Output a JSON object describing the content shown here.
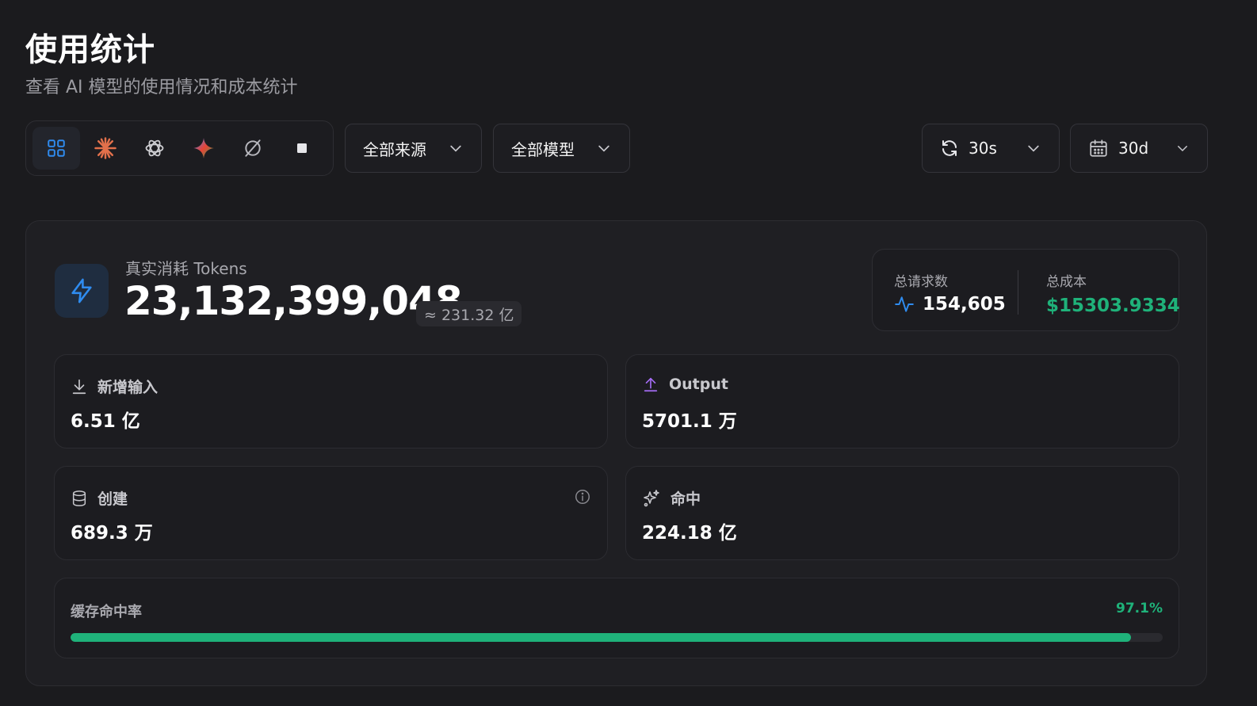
{
  "header": {
    "title": "使用统计",
    "subtitle": "查看 AI 模型的使用情况和成本统计"
  },
  "providers": [
    {
      "icon": "grid-icon",
      "active": true
    },
    {
      "icon": "claude-icon",
      "active": false
    },
    {
      "icon": "openai-icon",
      "active": false
    },
    {
      "icon": "gemini-icon",
      "active": false
    },
    {
      "icon": "custom-provider-icon",
      "active": false
    },
    {
      "icon": "square-icon",
      "active": false
    }
  ],
  "filters": {
    "source_label": "全部来源",
    "model_label": "全部模型",
    "refresh_label": "30s",
    "range_label": "30d"
  },
  "tokens": {
    "label": "真实消耗 Tokens",
    "value": "23,132,399,048",
    "approx": "≈ 231.32 亿"
  },
  "summary": {
    "requests_label": "总请求数",
    "requests_value": "154,605",
    "cost_label": "总成本",
    "cost_value": "$15303.9334"
  },
  "stats": {
    "input": {
      "label": "新增输入",
      "value": "6.51 亿"
    },
    "output": {
      "label": "Output",
      "value": "5701.1 万"
    },
    "created": {
      "label": "创建",
      "value": "689.3 万"
    },
    "hit": {
      "label": "命中",
      "value": "224.18 亿"
    }
  },
  "cache": {
    "label": "缓存命中率",
    "percent_text": "97.1%",
    "percent": 97.1
  },
  "colors": {
    "accent_blue": "#2f8cf0",
    "accent_green": "#1fb27a",
    "accent_purple": "#a56cf5",
    "claude_orange": "#e2704b"
  }
}
